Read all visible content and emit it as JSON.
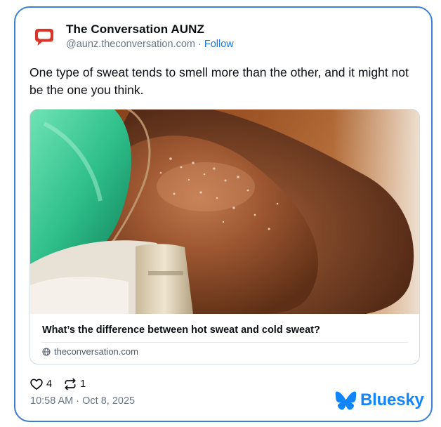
{
  "author": {
    "display_name": "The Conversation AUNZ",
    "handle": "@aunz.theconversation.com",
    "separator": " · ",
    "follow_label": "Follow",
    "avatar_icon": "speech-bubble-logo",
    "avatar_color": "#d8352a"
  },
  "post": {
    "text": "One type of sweat tends to smell more than the other, and it might not be the one you think."
  },
  "embed": {
    "image_alt": "close-up photo of a sweaty shoulder next to green fabric",
    "title": "What’s the difference between hot sweat and cold sweat?",
    "domain": "theconversation.com",
    "domain_icon": "globe-icon"
  },
  "stats": {
    "likes": "4",
    "reposts": "1"
  },
  "timestamp": "10:58 AM · Oct 8, 2025",
  "brand": {
    "name": "Bluesky",
    "color": "#1185fe"
  },
  "colors": {
    "card_border": "#3a7fd4",
    "link": "#1b79e6",
    "muted_text": "#6a7785"
  }
}
